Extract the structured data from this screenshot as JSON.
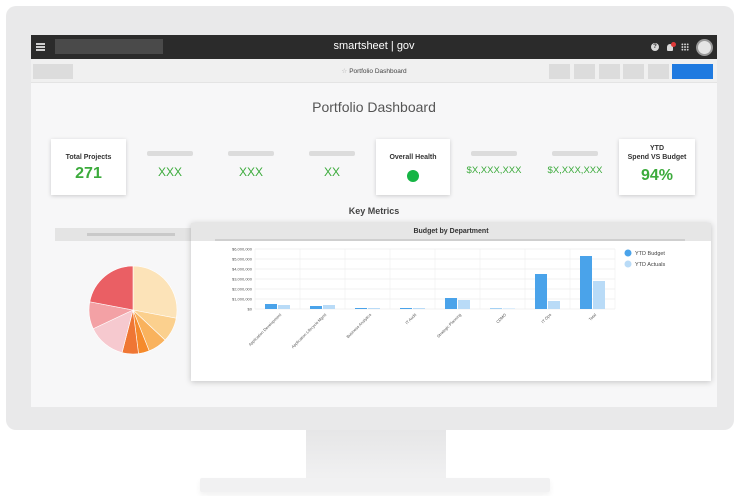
{
  "topbar": {
    "brand": "smartsheet | gov",
    "icons": [
      "menu-icon",
      "help-icon",
      "bell-icon",
      "apps-grid-icon",
      "avatar"
    ]
  },
  "toolbar": {
    "sheet_title": "Portfolio Dashboard",
    "star_icon": "☆",
    "share_color": "#1f7ae0"
  },
  "dashboard": {
    "title": "Portfolio Dashboard",
    "total_projects": {
      "label": "Total Projects",
      "value": "271"
    },
    "metric_1": "XXX",
    "metric_2": "XXX",
    "metric_3": "XX",
    "overall_health": {
      "label": "Overall Health",
      "status_color": "#16b545"
    },
    "metric_4": "$X,XXX,XXX",
    "metric_5": "$X,XXX,XXX",
    "ytd": {
      "label_line1": "YTD",
      "label_line2": "Spend VS Budget",
      "value": "94%"
    },
    "key_metrics": "Key Metrics",
    "accent_color": "#3cab3c"
  },
  "pie_chart": {
    "colors": [
      "#fce3b8",
      "#fbd08e",
      "#f9b25d",
      "#f58a2b",
      "#ef7634",
      "#f6c9cf",
      "#f3a1a5",
      "#ea5f64"
    ],
    "values": [
      28,
      9,
      7,
      4,
      6,
      14,
      10,
      22
    ]
  },
  "chart_data": {
    "type": "bar",
    "title": "Budget by Department",
    "categories": [
      "Application Development",
      "Application Lifecycle Mgmt",
      "Business Analytics",
      "IT Audit",
      "Strategic Planning",
      "CDMO",
      "IT Ops",
      "Total"
    ],
    "series": [
      {
        "name": "YTD Budget",
        "color": "#4aa3ea",
        "values": [
          500000,
          300000,
          100000,
          100000,
          1100000,
          50000,
          3500000,
          5300000
        ]
      },
      {
        "name": "YTD Actuals",
        "color": "#b9dbf7",
        "values": [
          400000,
          400000,
          100000,
          100000,
          900000,
          50000,
          800000,
          2800000
        ]
      }
    ],
    "y_ticks": [
      "$6,000,000",
      "$5,000,000",
      "$4,000,000",
      "$3,000,000",
      "$2,000,000",
      "$1,000,000",
      "$0"
    ],
    "ylim": [
      0,
      6000000
    ],
    "grid": true,
    "legend": "right"
  }
}
